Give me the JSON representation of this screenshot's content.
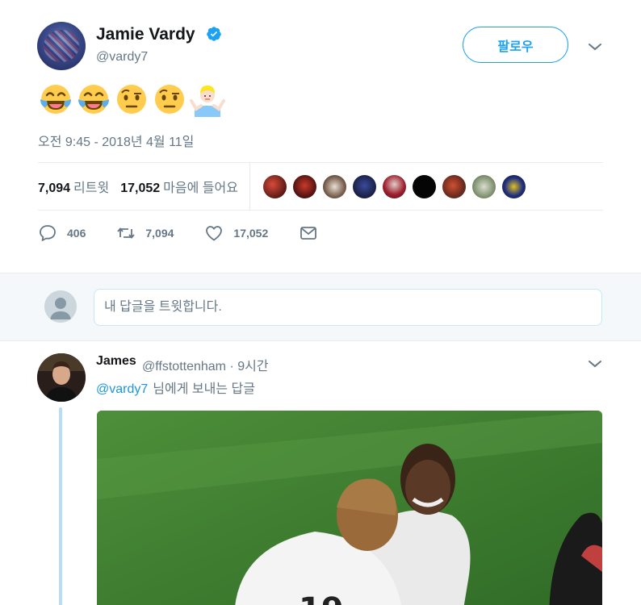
{
  "tweet": {
    "author_name": "Jamie Vardy",
    "author_handle": "@vardy7",
    "follow_label": "팔로우",
    "emojis": [
      "laughing-tears",
      "laughing-tears",
      "raised-eyebrow",
      "raised-eyebrow",
      "shrug"
    ],
    "timestamp": "오전 9:45 - 2018년 4월 11일",
    "stats": {
      "retweets_count": "7,094",
      "retweets_label": "리트윗",
      "likes_count": "17,052",
      "likes_label": "마음에 들어요"
    },
    "actions": {
      "replies": "406",
      "retweets": "7,094",
      "likes": "17,052"
    }
  },
  "reply_box": {
    "placeholder": "내 답글을 트윗합니다."
  },
  "reply": {
    "author_name": "James",
    "author_handle": "@ffstottenham · 9시간",
    "mention": "@vardy7",
    "replying_text": "님에게 보내는 답글"
  },
  "colors": {
    "accent": "#1da1f2",
    "verified": "#1da1f2",
    "muted": "#657786",
    "thread_line": "#b8ddf5"
  }
}
